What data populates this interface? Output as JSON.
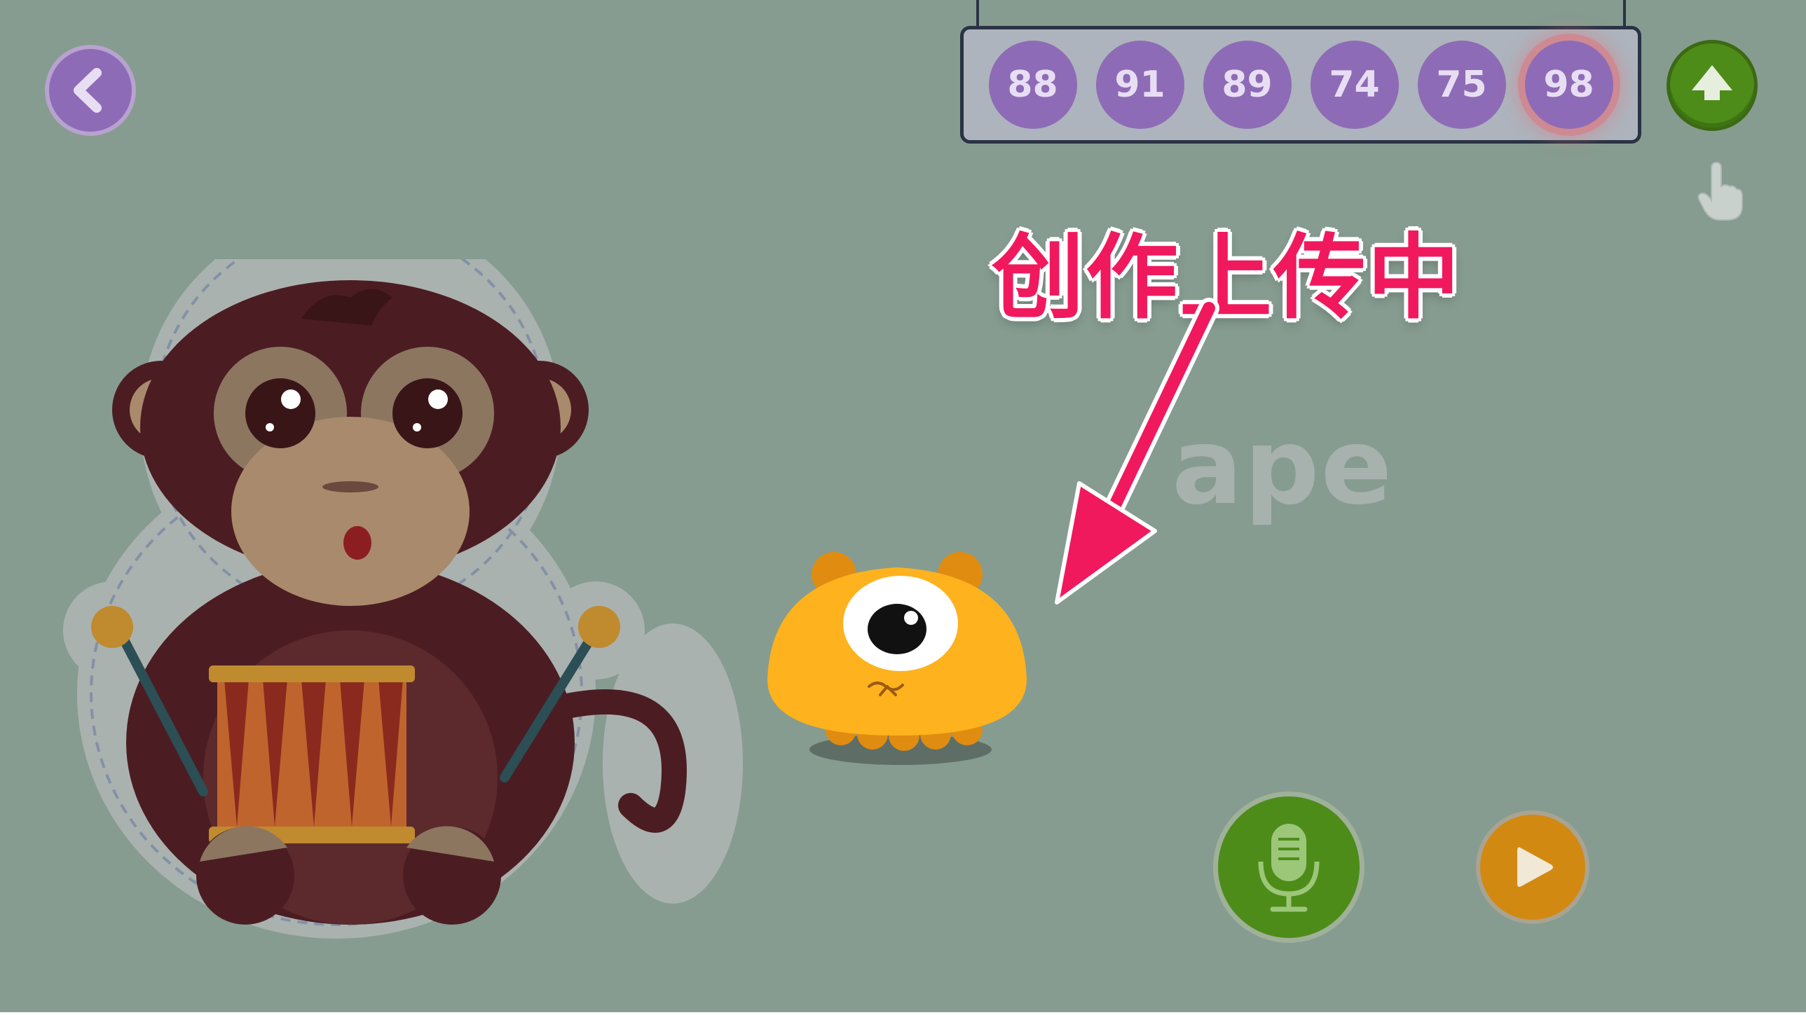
{
  "scores": {
    "values": [
      "88",
      "91",
      "89",
      "74",
      "75",
      "98"
    ],
    "active_index": 5
  },
  "annotation": {
    "text": "创作上传中"
  },
  "word": {
    "text": "ape"
  },
  "icons": {
    "back": "chevron-left-icon",
    "upload": "upload-arrow-icon",
    "hand": "hand-pointer-icon",
    "mic": "microphone-icon",
    "play": "play-icon"
  },
  "colors": {
    "background": "#869C90",
    "purple": "#8E6BB6",
    "green": "#4E8C1A",
    "orange": "#D28912",
    "annotation": "#F0195E",
    "mascot": "#FDB21E"
  }
}
